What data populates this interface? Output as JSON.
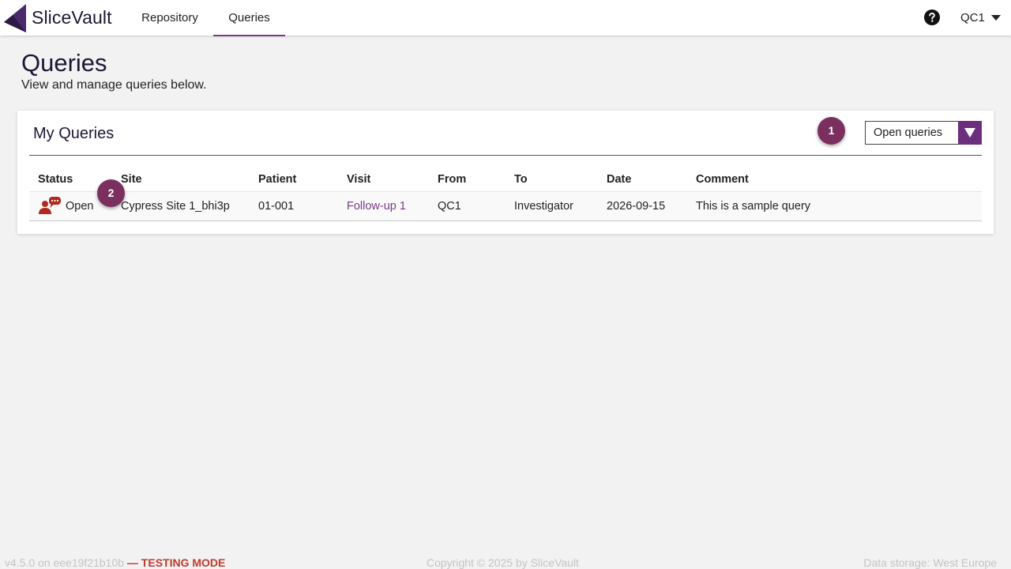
{
  "header": {
    "brand": "SliceVault",
    "nav": [
      {
        "label": "Repository",
        "active": false
      },
      {
        "label": "Queries",
        "active": true
      }
    ],
    "help_icon": "question-circle-icon",
    "user": "QC1"
  },
  "page": {
    "title": "Queries",
    "subtitle": "View and manage queries below."
  },
  "card": {
    "title": "My Queries",
    "filter": {
      "selected": "Open queries"
    },
    "badges": [
      "1",
      "2"
    ],
    "table": {
      "columns": [
        "Status",
        "Site",
        "Patient",
        "Visit",
        "From",
        "To",
        "Date",
        "Comment"
      ],
      "rows": [
        {
          "status": "Open",
          "status_icon": "user-speech-bubble-icon",
          "site": "Cypress Site 1_bhi3p",
          "patient": "01-001",
          "visit": "Follow-up 1",
          "from": "QC1",
          "to": "Investigator",
          "date": "2026-09-15",
          "comment": "This is a sample query"
        }
      ]
    }
  },
  "footer": {
    "version": "v4.5.0 on eee19f21b10b",
    "mode": "— TESTING MODE",
    "copyright": "Copyright © 2025 by SliceVault",
    "storage": "Data storage: West Europe"
  },
  "colors": {
    "accent": "#7a3c8a",
    "badge": "#7b2f5f",
    "status_open": "#b02a1e",
    "testing_mode": "#c0392b"
  }
}
